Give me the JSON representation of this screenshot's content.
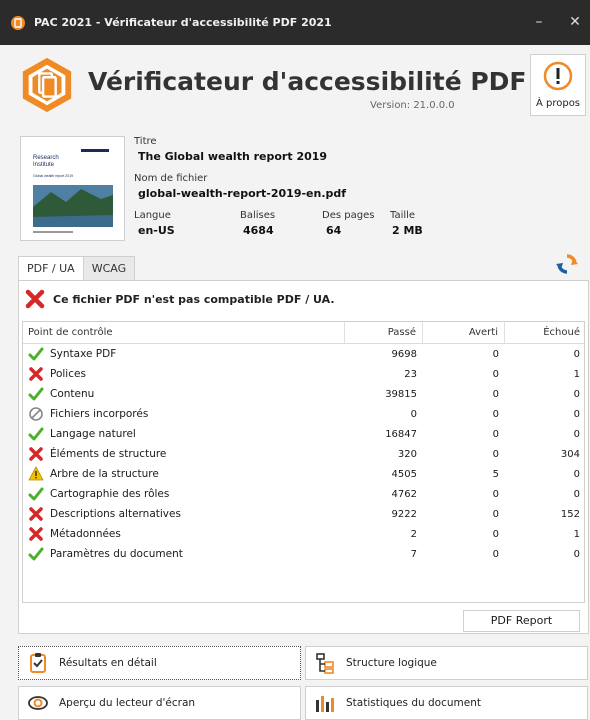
{
  "window": {
    "title": "PAC 2021 - Vérificateur d'accessibilité PDF 2021",
    "minimize": "–",
    "close": "✕"
  },
  "header": {
    "app_title": "Vérificateur d'accessibilité PDF 2021",
    "version": "Version: 21.0.0.0",
    "about_label": "À propos"
  },
  "document": {
    "title_label": "Titre",
    "title_value": "The Global wealth report 2019",
    "filename_label": "Nom de fichier",
    "filename_value": "global-wealth-report-2019-en.pdf",
    "language_label": "Langue",
    "language_value": "en-US",
    "tags_label": "Balises",
    "tags_value": "4684",
    "pages_label": "Des pages",
    "pages_value": "64",
    "size_label": "Taille",
    "size_value": "2 MB",
    "thumb_line1": "Research",
    "thumb_line2": "Institute",
    "thumb_subtitle": "Global wealth report 2019"
  },
  "tabs": [
    "PDF / UA",
    "WCAG"
  ],
  "status": {
    "message": "Ce fichier PDF n'est pas compatible PDF / UA."
  },
  "table": {
    "headers": [
      "Point de contrôle",
      "Passé",
      "Averti",
      "Échoué"
    ],
    "rows": [
      {
        "status": "pass",
        "name": "Syntaxe PDF",
        "passed": "9698",
        "warned": "0",
        "failed": "0"
      },
      {
        "status": "fail",
        "name": "Polices",
        "passed": "23",
        "warned": "0",
        "failed": "1"
      },
      {
        "status": "pass",
        "name": "Contenu",
        "passed": "39815",
        "warned": "0",
        "failed": "0"
      },
      {
        "status": "none",
        "name": "Fichiers incorporés",
        "passed": "0",
        "warned": "0",
        "failed": "0"
      },
      {
        "status": "pass",
        "name": "Langage naturel",
        "passed": "16847",
        "warned": "0",
        "failed": "0"
      },
      {
        "status": "fail",
        "name": "Éléments de structure",
        "passed": "320",
        "warned": "0",
        "failed": "304"
      },
      {
        "status": "warn",
        "name": "Arbre de la structure",
        "passed": "4505",
        "warned": "5",
        "failed": "0"
      },
      {
        "status": "pass",
        "name": "Cartographie des rôles",
        "passed": "4762",
        "warned": "0",
        "failed": "0"
      },
      {
        "status": "fail",
        "name": "Descriptions alternatives",
        "passed": "9222",
        "warned": "0",
        "failed": "152"
      },
      {
        "status": "fail",
        "name": "Métadonnées",
        "passed": "2",
        "warned": "0",
        "failed": "1"
      },
      {
        "status": "pass",
        "name": "Paramètres du document",
        "passed": "7",
        "warned": "0",
        "failed": "0"
      }
    ]
  },
  "report_button": "PDF Report",
  "bottom": {
    "detailed_results": "Résultats en détail",
    "logical_structure": "Structure logique",
    "screen_reader_preview": "Aperçu du lecteur d'écran",
    "document_statistics": "Statistiques du document"
  },
  "colors": {
    "pass": "#4caf2a",
    "fail": "#d62828",
    "warn": "#f2c200",
    "accent": "#f08a24"
  }
}
